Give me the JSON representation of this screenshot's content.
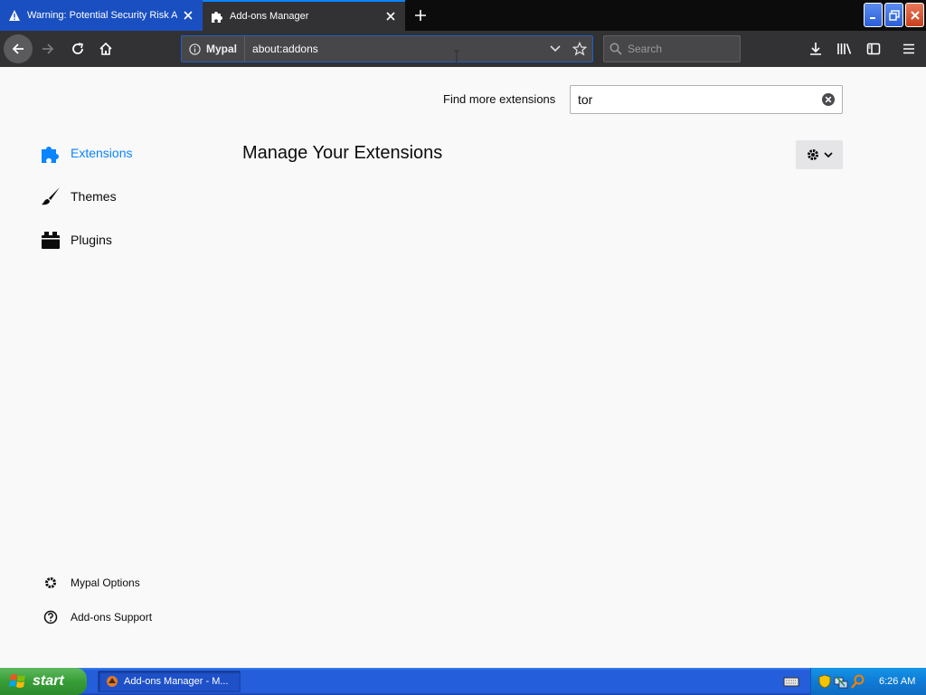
{
  "tabs": [
    {
      "title": "Warning: Potential Security Risk Ahead",
      "icon": "warning-icon",
      "active": false
    },
    {
      "title": "Add-ons Manager",
      "icon": "puzzle-icon",
      "active": true
    }
  ],
  "navbar": {
    "identity_label": "Mypal",
    "url": "about:addons",
    "search_placeholder": "Search"
  },
  "content": {
    "find_more_label": "Find more extensions",
    "search_value": "tor",
    "title": "Manage Your Extensions",
    "categories": [
      {
        "label": "Extensions",
        "icon": "puzzle-icon",
        "selected": true
      },
      {
        "label": "Themes",
        "icon": "brush-icon",
        "selected": false
      },
      {
        "label": "Plugins",
        "icon": "plugin-block-icon",
        "selected": false
      }
    ],
    "footer_links": [
      {
        "label": "Mypal Options",
        "icon": "gear-icon"
      },
      {
        "label": "Add-ons Support",
        "icon": "help-icon"
      }
    ]
  },
  "taskbar": {
    "start_label": "start",
    "task_item_label": "Add-ons Manager - M...",
    "clock": "6:26 AM"
  },
  "colors": {
    "accent": "#0a84ff",
    "tab_active_bg": "#323234",
    "tab_inactive_bg": "#1a4fc1",
    "content_bg": "#f9f9fa"
  }
}
